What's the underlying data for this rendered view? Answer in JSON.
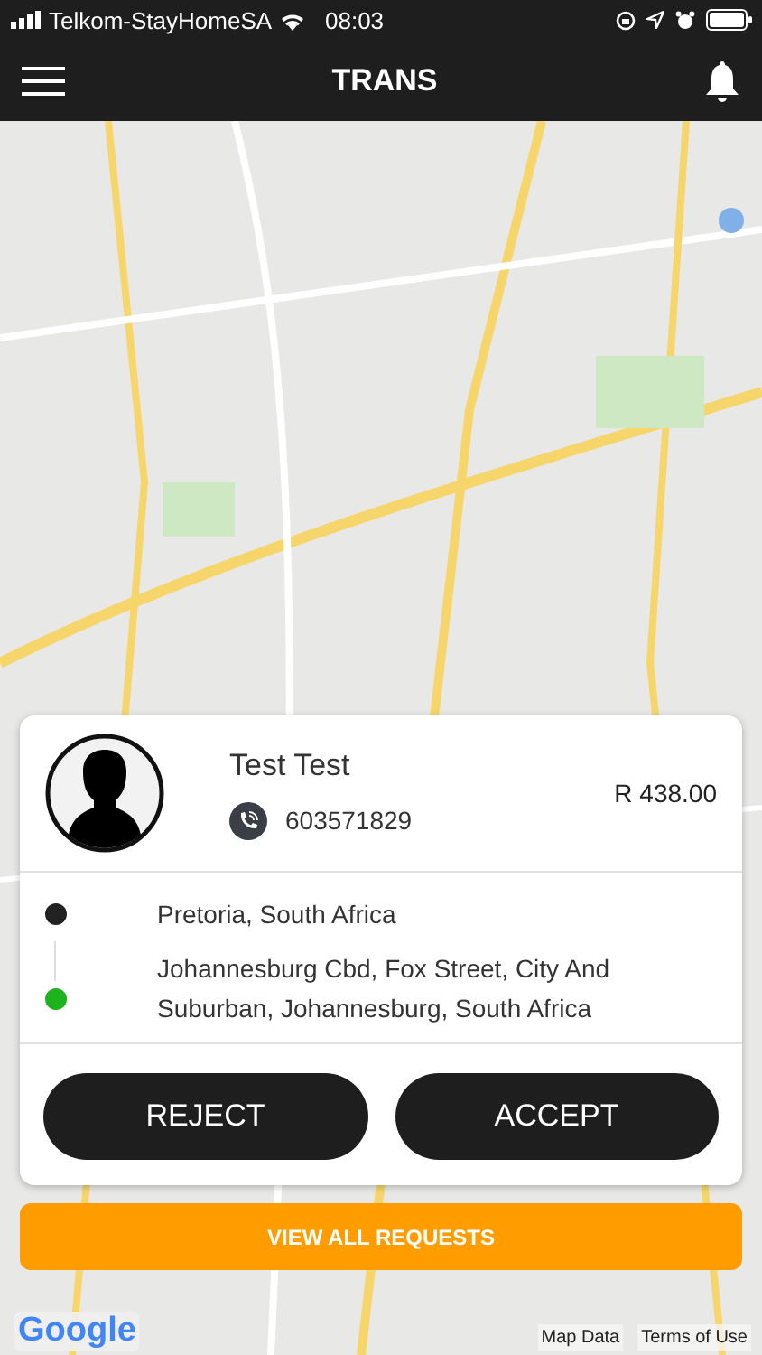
{
  "status_bar": {
    "carrier": "Telkom-StayHomeSA",
    "time": "08:03"
  },
  "header": {
    "title": "TRANS"
  },
  "request": {
    "name": "Test Test",
    "phone": "603571829",
    "fare": "R 438.00",
    "stops": [
      {
        "address": "Pretoria, South Africa",
        "color": "#222222"
      },
      {
        "address": "Johannesburg Cbd, Fox Street, City And Suburban, Johannesburg, South Africa",
        "color": "#1db31d"
      }
    ],
    "buttons": [
      "REJECT",
      "ACCEPT"
    ]
  },
  "view_all_button": "VIEW ALL REQUESTS",
  "map": {
    "logo": "Google",
    "attribution": [
      "Map Data",
      "Terms of Use"
    ]
  }
}
